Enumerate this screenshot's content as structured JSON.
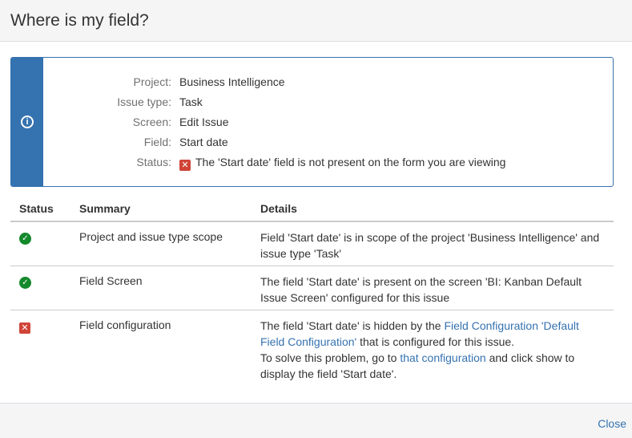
{
  "dialog": {
    "title": "Where is my field?"
  },
  "message": {
    "icon": "info-circle-icon",
    "rows": [
      {
        "label": "Project:",
        "value": "Business Intelligence"
      },
      {
        "label": "Issue type:",
        "value": "Task"
      },
      {
        "label": "Screen:",
        "value": "Edit Issue"
      },
      {
        "label": "Field:",
        "value": "Start date"
      },
      {
        "label": "Status:",
        "value": "The 'Start date' field is not present on the form you are viewing",
        "icon": "error-x-icon"
      }
    ]
  },
  "table": {
    "headers": {
      "status": "Status",
      "summary": "Summary",
      "details": "Details"
    },
    "rows": [
      {
        "status_icon": "check-circle-icon",
        "summary": "Project and issue type scope",
        "details_line1": "Field 'Start date' is in scope of the project 'Business Intelligence' and",
        "details_line2": "issue type 'Task'"
      },
      {
        "status_icon": "check-circle-icon",
        "summary": "Field Screen",
        "details_line1": "The field 'Start date' is present on the screen 'BI: Kanban Default",
        "details_line2": "Issue Screen' configured for this issue"
      },
      {
        "status_icon": "error-x-icon",
        "summary": "Field configuration",
        "details": {
          "part1": "The field 'Start date' is hidden by the ",
          "link1": "Field Configuration 'Default Field Configuration'",
          "part2": " that is configured for this issue.",
          "part3": "To solve this problem, go to ",
          "link2": "that configuration",
          "part4": " and click show to display the field 'Start date'."
        }
      }
    ]
  },
  "footer": {
    "close_label": "Close"
  },
  "colors": {
    "accent": "#3572b0",
    "success": "#14892c",
    "error": "#d04437"
  }
}
